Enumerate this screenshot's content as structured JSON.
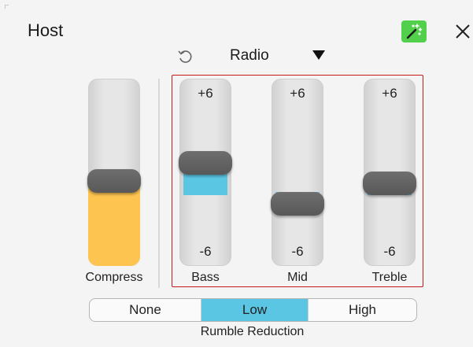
{
  "window": {
    "title": "Host"
  },
  "toolbar": {
    "magic_icon": "magic-wand-icon",
    "close_icon": "close-icon",
    "accent": "#52d04b"
  },
  "preset": {
    "name": "Radio",
    "undo_icon": "undo-icon",
    "dropdown_icon": "dropdown-arrow-icon"
  },
  "compressor": {
    "label": "Compress",
    "level_percent": 50,
    "color": "#fdc450"
  },
  "eq": {
    "range_top": "+6",
    "range_bottom": "-6",
    "bands": [
      {
        "label": "Bass",
        "value": 3
      },
      {
        "label": "Mid",
        "value": -1
      },
      {
        "label": "Treble",
        "value": 1
      }
    ],
    "fill_color": "#5bc6e4",
    "highlight_color": "#c41a1a"
  },
  "rumble": {
    "caption": "Rumble Reduction",
    "options": [
      "None",
      "Low",
      "High"
    ],
    "selected": "Low"
  }
}
